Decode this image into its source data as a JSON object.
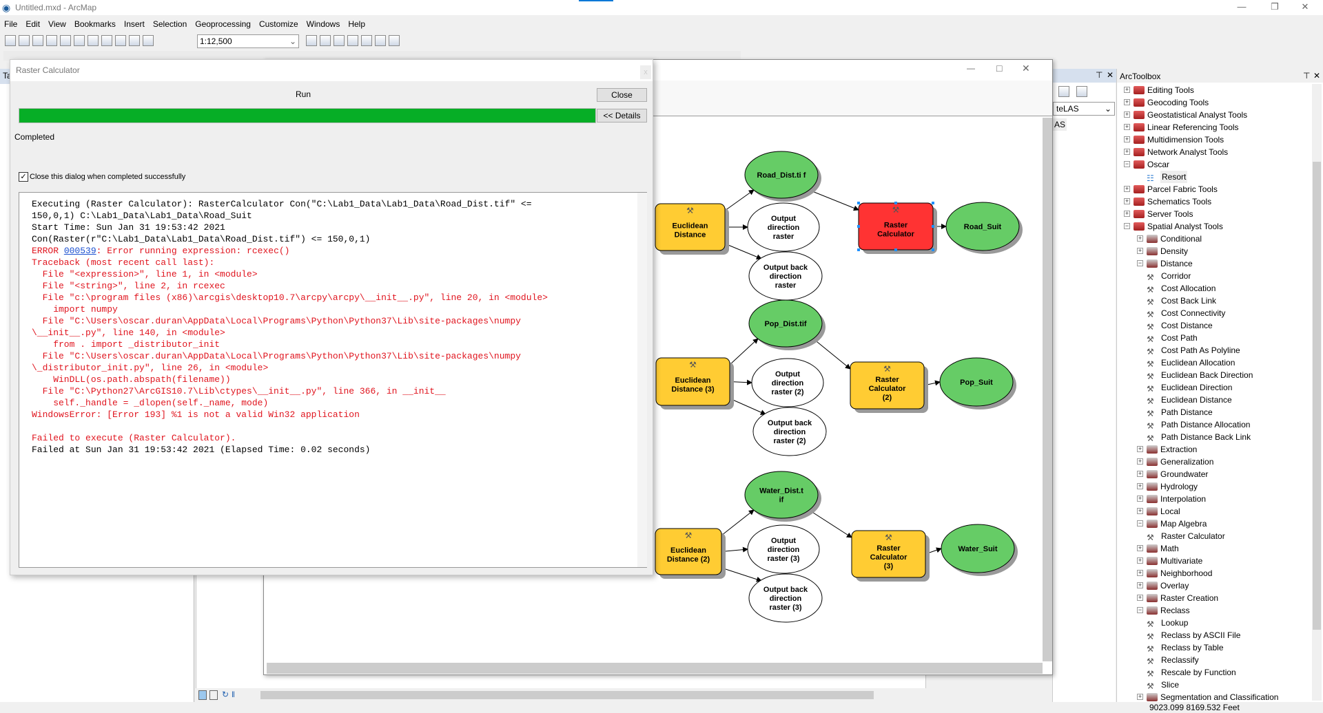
{
  "app": {
    "title": "Untitled.mxd - ArcMap"
  },
  "menu": [
    "File",
    "Edit",
    "View",
    "Bookmarks",
    "Insert",
    "Selection",
    "Geoprocessing",
    "Customize",
    "Windows",
    "Help"
  ],
  "toolbar": {
    "scale": "1:12,500"
  },
  "toc": {
    "title": "Ta"
  },
  "catalog": {
    "dropdown": "teLAS",
    "item": "AS"
  },
  "dialog": {
    "title": "Raster Calculator",
    "close_x": "x",
    "run_label": "Run",
    "progress_percent": 100,
    "close_button": "Close",
    "details_button": "<< Details",
    "status": "Completed",
    "checkbox_label": "Close this dialog when completed successfully",
    "checkbox_checked": true,
    "log": [
      {
        "c": "blk",
        "t": "Executing (Raster Calculator): RasterCalculator Con(\"C:\\Lab1_Data\\Lab1_Data\\Road_Dist.tif\" <="
      },
      {
        "c": "blk",
        "t": "150,0,1) C:\\Lab1_Data\\Lab1_Data\\Road_Suit"
      },
      {
        "c": "blk",
        "t": "Start Time: Sun Jan 31 19:53:42 2021"
      },
      {
        "c": "blk",
        "t": "Con(Raster(r\"C:\\Lab1_Data\\Lab1_Data\\Road_Dist.tif\") <= 150,0,1)"
      },
      {
        "c": "red",
        "pre": "ERROR ",
        "link": "000539",
        "t": ": Error running expression: rcexec()"
      },
      {
        "c": "red",
        "t": "Traceback (most recent call last):"
      },
      {
        "c": "red",
        "t": "  File \"<expression>\", line 1, in <module>"
      },
      {
        "c": "red",
        "t": "  File \"<string>\", line 2, in rcexec"
      },
      {
        "c": "red",
        "t": "  File \"c:\\program files (x86)\\arcgis\\desktop10.7\\arcpy\\arcpy\\__init__.py\", line 20, in <module>"
      },
      {
        "c": "red",
        "t": "    import numpy"
      },
      {
        "c": "red",
        "t": "  File \"C:\\Users\\oscar.duran\\AppData\\Local\\Programs\\Python\\Python37\\Lib\\site-packages\\numpy"
      },
      {
        "c": "red",
        "t": "\\__init__.py\", line 140, in <module>"
      },
      {
        "c": "red",
        "t": "    from . import _distributor_init"
      },
      {
        "c": "red",
        "t": "  File \"C:\\Users\\oscar.duran\\AppData\\Local\\Programs\\Python\\Python37\\Lib\\site-packages\\numpy"
      },
      {
        "c": "red",
        "t": "\\_distributor_init.py\", line 26, in <module>"
      },
      {
        "c": "red",
        "t": "    WinDLL(os.path.abspath(filename))"
      },
      {
        "c": "red",
        "t": "  File \"C:\\Python27\\ArcGIS10.7\\Lib\\ctypes\\__init__.py\", line 366, in __init__"
      },
      {
        "c": "red",
        "t": "    self._handle = _dlopen(self._name, mode)"
      },
      {
        "c": "red",
        "t": "WindowsError: [Error 193] %1 is not a valid Win32 application"
      },
      {
        "c": "red",
        "t": " "
      },
      {
        "c": "red",
        "t": "Failed to execute (Raster Calculator)."
      },
      {
        "c": "blk",
        "t": "Failed at Sun Jan 31 19:53:42 2021 (Elapsed Time: 0.02 seconds)"
      }
    ]
  },
  "model": {
    "nodes": [
      {
        "label": "Euclidean Distance",
        "kind": "tool",
        "fill": "#ffcc33"
      },
      {
        "label": "Road_Dist.ti f",
        "kind": "data",
        "fill": "#66cc66"
      },
      {
        "label": "Output direction raster",
        "kind": "data",
        "fill": "#ffffff"
      },
      {
        "label": "Output back direction raster",
        "kind": "data",
        "fill": "#ffffff"
      },
      {
        "label": "Raster Calculator",
        "kind": "tool",
        "fill": "#ff3333",
        "selected": true
      },
      {
        "label": "Road_Suit",
        "kind": "data",
        "fill": "#66cc66"
      },
      {
        "label": "Euclidean Distance (3)",
        "kind": "tool",
        "fill": "#ffcc33"
      },
      {
        "label": "Pop_Dist.tif",
        "kind": "data",
        "fill": "#66cc66"
      },
      {
        "label": "Output direction raster (2)",
        "kind": "data",
        "fill": "#ffffff"
      },
      {
        "label": "Output back direction raster (2)",
        "kind": "data",
        "fill": "#ffffff"
      },
      {
        "label": "Raster Calculator (2)",
        "kind": "tool",
        "fill": "#ffcc33"
      },
      {
        "label": "Pop_Suit",
        "kind": "data",
        "fill": "#66cc66"
      },
      {
        "label": "Euclidean Distance (2)",
        "kind": "tool",
        "fill": "#ffcc33"
      },
      {
        "label": "Water_Dist.t if",
        "kind": "data",
        "fill": "#66cc66"
      },
      {
        "label": "Output direction raster (3)",
        "kind": "data",
        "fill": "#ffffff"
      },
      {
        "label": "Output back direction raster (3)",
        "kind": "data",
        "fill": "#ffffff"
      },
      {
        "label": "Raster Calculator (3)",
        "kind": "tool",
        "fill": "#ffcc33"
      },
      {
        "label": "Water_Suit",
        "kind": "data",
        "fill": "#66cc66"
      }
    ]
  },
  "toolbox": {
    "title": "ArcToolbox",
    "items": [
      {
        "l": 0,
        "t": "Editing Tools",
        "e": "+",
        "i": "box"
      },
      {
        "l": 0,
        "t": "Geocoding Tools",
        "e": "+",
        "i": "box"
      },
      {
        "l": 0,
        "t": "Geostatistical Analyst Tools",
        "e": "+",
        "i": "box"
      },
      {
        "l": 0,
        "t": "Linear Referencing Tools",
        "e": "+",
        "i": "box"
      },
      {
        "l": 0,
        "t": "Multidimension Tools",
        "e": "+",
        "i": "box"
      },
      {
        "l": 0,
        "t": "Network Analyst Tools",
        "e": "+",
        "i": "box"
      },
      {
        "l": 0,
        "t": "Oscar",
        "e": "-",
        "i": "box"
      },
      {
        "l": 1,
        "t": "Resort",
        "e": "",
        "i": "model"
      },
      {
        "l": 0,
        "t": "Parcel Fabric Tools",
        "e": "+",
        "i": "box"
      },
      {
        "l": 0,
        "t": "Schematics Tools",
        "e": "+",
        "i": "box"
      },
      {
        "l": 0,
        "t": "Server Tools",
        "e": "+",
        "i": "box"
      },
      {
        "l": 0,
        "t": "Spatial Analyst Tools",
        "e": "-",
        "i": "box"
      },
      {
        "l": 1,
        "t": "Conditional",
        "e": "+",
        "i": "set"
      },
      {
        "l": 1,
        "t": "Density",
        "e": "+",
        "i": "set"
      },
      {
        "l": 1,
        "t": "Distance",
        "e": "-",
        "i": "set"
      },
      {
        "l": 2,
        "t": "Corridor",
        "e": "",
        "i": "tool"
      },
      {
        "l": 2,
        "t": "Cost Allocation",
        "e": "",
        "i": "tool"
      },
      {
        "l": 2,
        "t": "Cost Back Link",
        "e": "",
        "i": "tool"
      },
      {
        "l": 2,
        "t": "Cost Connectivity",
        "e": "",
        "i": "tool"
      },
      {
        "l": 2,
        "t": "Cost Distance",
        "e": "",
        "i": "tool"
      },
      {
        "l": 2,
        "t": "Cost Path",
        "e": "",
        "i": "tool"
      },
      {
        "l": 2,
        "t": "Cost Path As Polyline",
        "e": "",
        "i": "tool"
      },
      {
        "l": 2,
        "t": "Euclidean Allocation",
        "e": "",
        "i": "tool"
      },
      {
        "l": 2,
        "t": "Euclidean Back Direction",
        "e": "",
        "i": "tool"
      },
      {
        "l": 2,
        "t": "Euclidean Direction",
        "e": "",
        "i": "tool"
      },
      {
        "l": 2,
        "t": "Euclidean Distance",
        "e": "",
        "i": "tool"
      },
      {
        "l": 2,
        "t": "Path Distance",
        "e": "",
        "i": "tool"
      },
      {
        "l": 2,
        "t": "Path Distance Allocation",
        "e": "",
        "i": "tool"
      },
      {
        "l": 2,
        "t": "Path Distance Back Link",
        "e": "",
        "i": "tool"
      },
      {
        "l": 1,
        "t": "Extraction",
        "e": "+",
        "i": "set"
      },
      {
        "l": 1,
        "t": "Generalization",
        "e": "+",
        "i": "set"
      },
      {
        "l": 1,
        "t": "Groundwater",
        "e": "+",
        "i": "set"
      },
      {
        "l": 1,
        "t": "Hydrology",
        "e": "+",
        "i": "set"
      },
      {
        "l": 1,
        "t": "Interpolation",
        "e": "+",
        "i": "set"
      },
      {
        "l": 1,
        "t": "Local",
        "e": "+",
        "i": "set"
      },
      {
        "l": 1,
        "t": "Map Algebra",
        "e": "-",
        "i": "set"
      },
      {
        "l": 2,
        "t": "Raster Calculator",
        "e": "",
        "i": "tool"
      },
      {
        "l": 1,
        "t": "Math",
        "e": "+",
        "i": "set"
      },
      {
        "l": 1,
        "t": "Multivariate",
        "e": "+",
        "i": "set"
      },
      {
        "l": 1,
        "t": "Neighborhood",
        "e": "+",
        "i": "set"
      },
      {
        "l": 1,
        "t": "Overlay",
        "e": "+",
        "i": "set"
      },
      {
        "l": 1,
        "t": "Raster Creation",
        "e": "+",
        "i": "set"
      },
      {
        "l": 1,
        "t": "Reclass",
        "e": "-",
        "i": "set"
      },
      {
        "l": 2,
        "t": "Lookup",
        "e": "",
        "i": "tool"
      },
      {
        "l": 2,
        "t": "Reclass by ASCII File",
        "e": "",
        "i": "tool"
      },
      {
        "l": 2,
        "t": "Reclass by Table",
        "e": "",
        "i": "tool"
      },
      {
        "l": 2,
        "t": "Reclassify",
        "e": "",
        "i": "tool"
      },
      {
        "l": 2,
        "t": "Rescale by Function",
        "e": "",
        "i": "tool"
      },
      {
        "l": 2,
        "t": "Slice",
        "e": "",
        "i": "tool"
      },
      {
        "l": 1,
        "t": "Segmentation and Classification",
        "e": "+",
        "i": "set"
      }
    ]
  },
  "status": {
    "coords": "9023.099  8169.532 Feet"
  }
}
